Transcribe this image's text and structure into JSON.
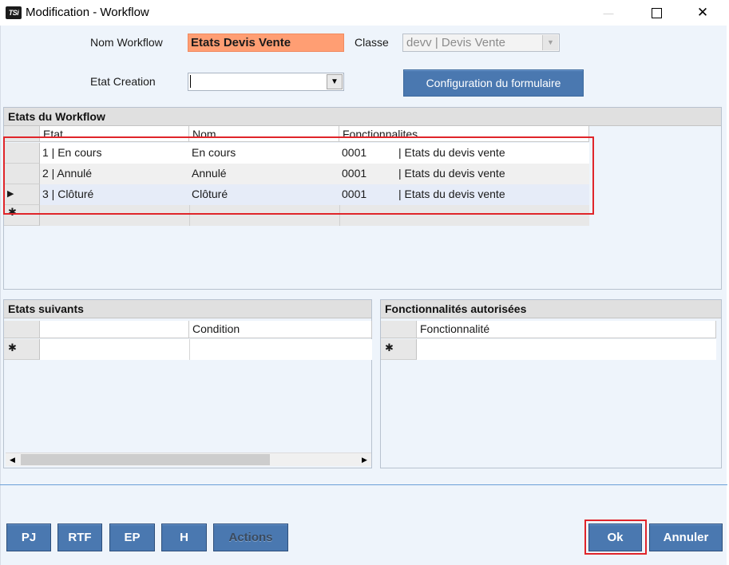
{
  "window": {
    "app_icon_text": "TSi",
    "title": "Modification - Workflow",
    "minimize_glyph": "—",
    "maximize_glyph": "☐",
    "close_glyph": "✕"
  },
  "form": {
    "nom_label": "Nom Workflow",
    "nom_value": "Etats Devis Vente",
    "classe_label": "Classe",
    "classe_value": "devv | Devis Vente",
    "etat_label": "Etat Creation",
    "etat_value": "",
    "config_button": "Configuration du formulaire"
  },
  "workflow_panel": {
    "title": "Etats du Workflow",
    "columns": [
      "Etat",
      "Nom",
      "Fonctionnalites"
    ],
    "rows": [
      {
        "etat": "1 | En cours",
        "nom": "En cours",
        "code": "0001",
        "fonct": "| Etats du devis vente"
      },
      {
        "etat": "2 | Annulé",
        "nom": "Annulé",
        "code": "0001",
        "fonct": "| Etats du devis vente"
      },
      {
        "etat": "3 | Clôturé",
        "nom": "Clôturé",
        "code": "0001",
        "fonct": "| Etats du devis vente"
      }
    ],
    "current_row_marker": "▶",
    "new_row_marker": "✱"
  },
  "suivants_panel": {
    "title": "Etats suivants",
    "columns": [
      "",
      "Condition"
    ],
    "new_row_marker": "✱",
    "scroll_left": "◀",
    "scroll_right": "▶"
  },
  "fonctionnalites_panel": {
    "title": "Fonctionnalités autorisées",
    "columns": [
      "Fonctionnalité"
    ],
    "new_row_marker": "✱"
  },
  "footer": {
    "buttons": [
      "PJ",
      "RTF",
      "EP",
      "H",
      "Actions"
    ],
    "ok": "Ok",
    "annuler": "Annuler"
  },
  "colors": {
    "accent_button": "#4a78b0",
    "highlight_red": "#e0252a",
    "nom_field_bg": "#ff9e73"
  }
}
